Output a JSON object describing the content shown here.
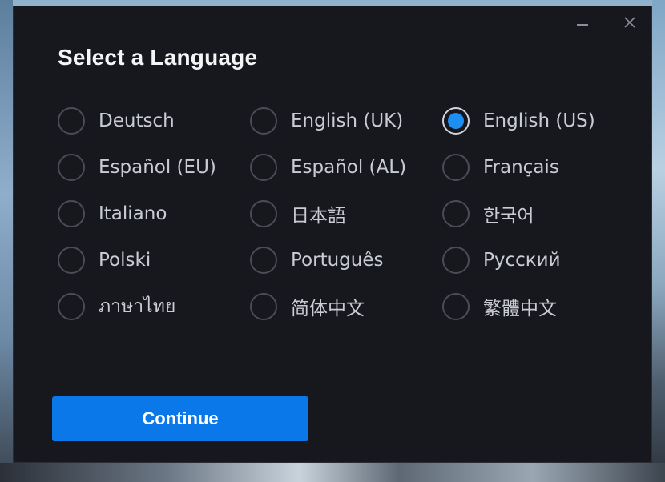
{
  "dialog": {
    "title": "Select a Language",
    "minimize_icon": "minimize-icon",
    "close_icon": "close-icon",
    "selected_language": "English (US)",
    "accent_color": "#1e8ef0",
    "languages": [
      {
        "label": "Deutsch",
        "checked": false
      },
      {
        "label": "English (UK)",
        "checked": false
      },
      {
        "label": "English (US)",
        "checked": true
      },
      {
        "label": "Español (EU)",
        "checked": false
      },
      {
        "label": "Español (AL)",
        "checked": false
      },
      {
        "label": "Français",
        "checked": false
      },
      {
        "label": "Italiano",
        "checked": false
      },
      {
        "label": "日本語",
        "checked": false
      },
      {
        "label": "한국어",
        "checked": false
      },
      {
        "label": "Polski",
        "checked": false
      },
      {
        "label": "Português",
        "checked": false
      },
      {
        "label": "Русский",
        "checked": false
      },
      {
        "label": "ภาษาไทย",
        "checked": false
      },
      {
        "label": "简体中文",
        "checked": false
      },
      {
        "label": "繁體中文",
        "checked": false
      }
    ],
    "continue_label": "Continue",
    "button_color": "#0a78e8"
  }
}
